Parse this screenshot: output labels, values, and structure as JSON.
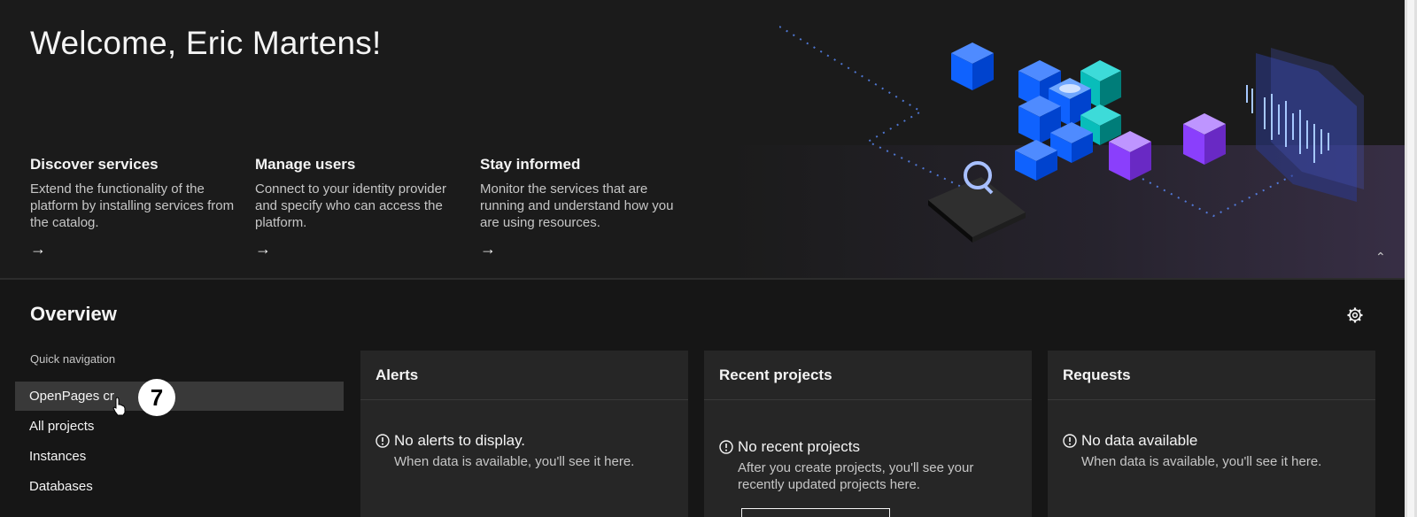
{
  "hero": {
    "welcome": "Welcome, Eric Martens!",
    "features": [
      {
        "title": "Discover services",
        "desc": "Extend the functionality of the platform by installing services from the catalog.",
        "arrow": "→"
      },
      {
        "title": "Manage users",
        "desc": "Connect to your identity provider and specify who can access the platform.",
        "arrow": "→"
      },
      {
        "title": "Stay informed",
        "desc": "Monitor the services that are running and understand how you are using resources.",
        "arrow": "→"
      }
    ],
    "collapse_icon": "⌃"
  },
  "overview": {
    "title": "Overview",
    "quick_nav_label": "Quick navigation",
    "quick_nav_items": [
      "OpenPages cr",
      "All projects",
      "Instances",
      "Databases"
    ],
    "step_badge": "7"
  },
  "cards": [
    {
      "title": "Alerts",
      "msg_title": "No alerts to display.",
      "msg_sub": "When data is available, you'll see it here."
    },
    {
      "title": "Recent projects",
      "msg_title": "No recent projects",
      "msg_sub": "After you create projects, you'll see your recently updated projects here."
    },
    {
      "title": "Requests",
      "msg_title": "No data available",
      "msg_sub": "When data is available, you'll see it here."
    }
  ],
  "colors": {
    "background": "#161616",
    "card": "#262626",
    "accent_blue": "#0f62fe",
    "accent_purple": "#8a3ffc"
  }
}
